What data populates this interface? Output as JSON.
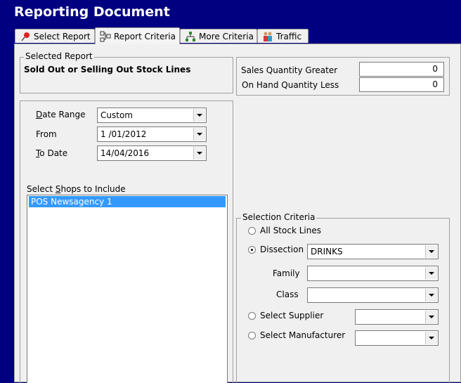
{
  "window": {
    "title": "Reporting Document"
  },
  "tabs": [
    {
      "label": "Select Report",
      "icon": "pushpin-icon"
    },
    {
      "label": "Report Criteria",
      "icon": "network-tree-icon"
    },
    {
      "label": "More Criteria",
      "icon": "branch-tree-icon"
    },
    {
      "label": "Traffic",
      "icon": "people-icon"
    }
  ],
  "selected_report": {
    "group_label": "Selected Report",
    "name": "Sold Out or Selling Out Stock Lines"
  },
  "quantities": {
    "sales_label": "Sales Quantity Greater",
    "sales_value": "0",
    "onhand_label": "On Hand Quantity Less",
    "onhand_value": "0"
  },
  "dates": {
    "range_label": "Date Range",
    "range_value": "Custom",
    "from_label": "From",
    "from_value": "1 /01/2012",
    "to_label": "To Date",
    "to_value": "14/04/2016"
  },
  "shops": {
    "label": "Select Shops to Include",
    "items": [
      "POS Newsagency 1"
    ]
  },
  "selection": {
    "group_label": "Selection Criteria",
    "all_label": "All Stock Lines",
    "dissection_label": "Dissection",
    "dissection_value": "DRINKS",
    "family_label": "Family",
    "family_value": "",
    "class_label": "Class",
    "class_value": "",
    "supplier_label": "Select Supplier",
    "supplier_value": "",
    "manufacturer_label": "Select Manufacturer",
    "manufacturer_value": "",
    "selected_option": "Dissection"
  }
}
